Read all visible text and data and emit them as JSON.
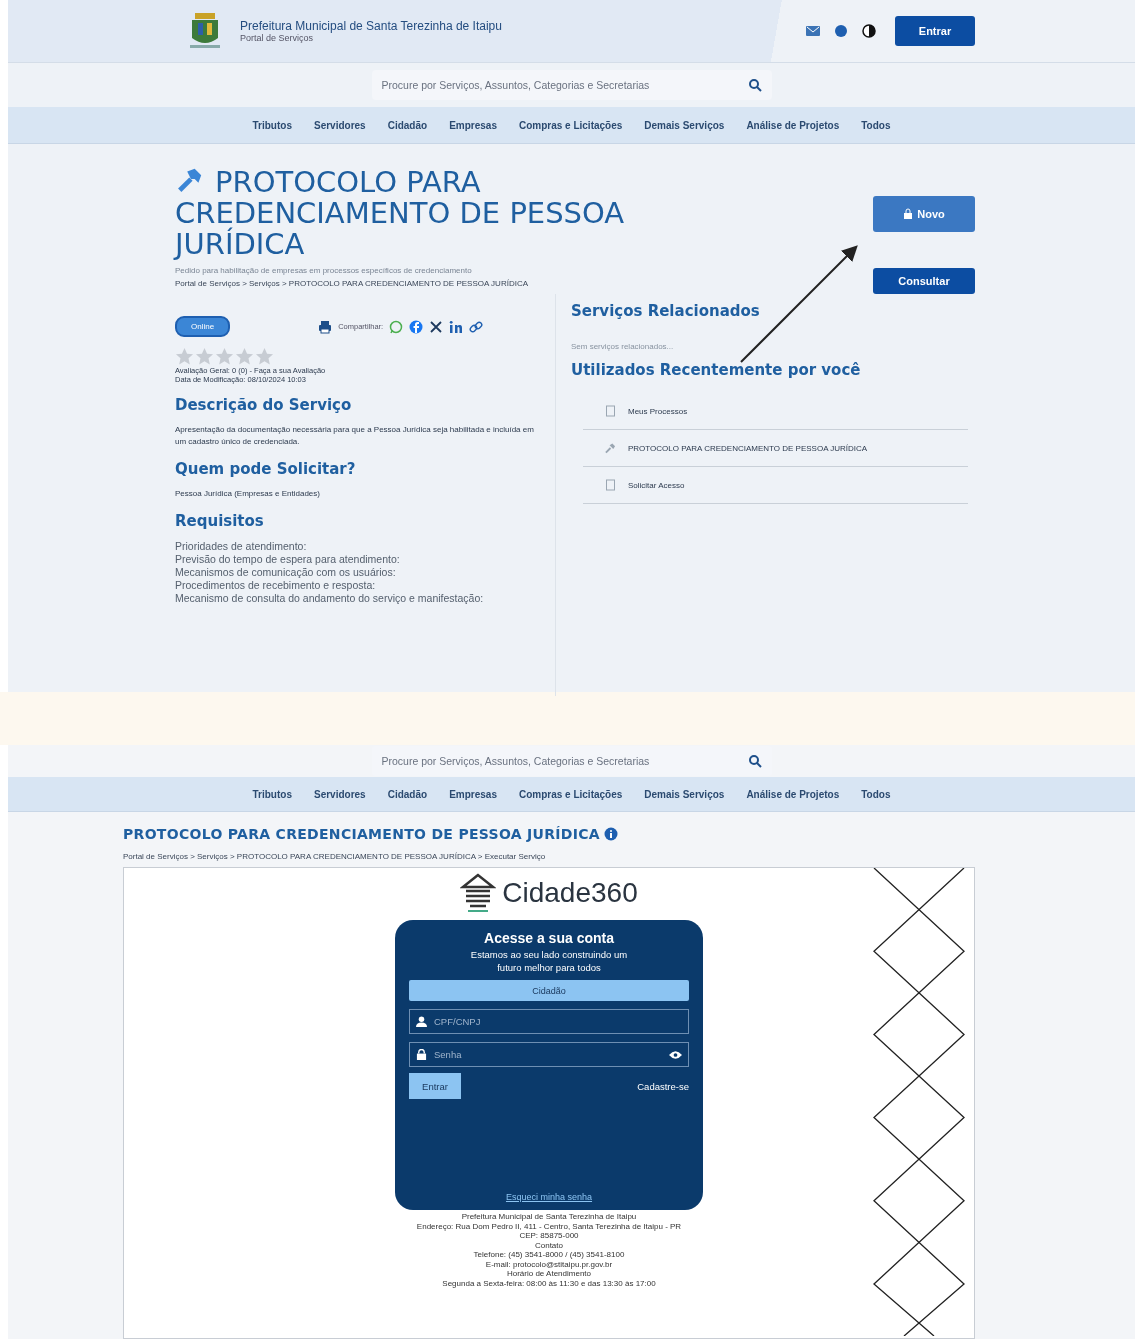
{
  "header": {
    "title": "Prefeitura Municipal de Santa Terezinha de Itaipu",
    "subtitle": "Portal de Serviços",
    "login_button": "Entrar"
  },
  "search": {
    "placeholder": "Procure por Serviços, Assuntos, Categorias e Secretarias"
  },
  "nav": [
    "Tributos",
    "Servidores",
    "Cidadão",
    "Empresas",
    "Compras e Licitações",
    "Demais Serviços",
    "Análise de Projetos",
    "Todos"
  ],
  "service": {
    "title": "PROTOCOLO PARA CREDENCIAMENTO DE PESSOA JURÍDICA",
    "summary": "Pedido para habilitação de empresas em processos específicos de credenciamento",
    "breadcrumb": "Portal de Serviços > Serviços > PROTOCOLO PARA CREDENCIAMENTO DE PESSOA JURÍDICA",
    "badge": "Online",
    "share_label": "Compartilhar:",
    "stars": 0,
    "rating": "Avaliação Geral: 0 (0) - Faça a sua Avaliação",
    "modified": "Data de Modificação: 08/10/2024 10:03",
    "sections": [
      {
        "heading": "Descrição do Serviço",
        "lines": [
          "Apresentação da documentação necessária para que a Pessoa Jurídica seja habilitada e incluída em um cadastro único de credenciada."
        ],
        "kind": "small"
      },
      {
        "heading": "Quem pode Solicitar?",
        "lines": [
          "Pessoa Jurídica (Empresas e Entidades)"
        ],
        "kind": "small"
      },
      {
        "heading": "Requisitos",
        "lines": [
          "Prioridades de atendimento:",
          "Previsão do tempo de espera para atendimento:",
          "Mecanismos de comunicação com os usuários:",
          "Procedimentos de recebimento e resposta:",
          "Mecanismo de consulta do andamento do serviço e manifestação:"
        ],
        "kind": "large"
      }
    ],
    "buttons": [
      "Novo",
      "Consultar"
    ],
    "related": {
      "heading": "Serviços Relacionados",
      "empty": "Sem serviços relacionados..."
    },
    "recent": {
      "heading": "Utilizados Recentemente por você",
      "items": [
        {
          "label": "Meus Processos",
          "kind": "document"
        },
        {
          "label": "PROTOCOLO PARA CREDENCIAMENTO DE PESSOA JURÍDICA",
          "kind": "hammer"
        },
        {
          "label": "Solicitar Acesso",
          "kind": "document"
        }
      ]
    }
  },
  "execute": {
    "search": {
      "placeholder": "Procure por Serviços, Assuntos, Categorias e Secretarias"
    },
    "nav": [
      "Tributos",
      "Servidores",
      "Cidadão",
      "Empresas",
      "Compras e Licitações",
      "Demais Serviços",
      "Análise de Projetos",
      "Todos"
    ],
    "title": "PROTOCOLO PARA CREDENCIAMENTO DE PESSOA JURÍDICA",
    "breadcrumb": "Portal de Serviços > Serviços > PROTOCOLO PARA CREDENCIAMENTO DE PESSOA JURÍDICA > Executar Serviço",
    "login": {
      "brand": "Cidade",
      "brand_number": "360",
      "title": "Acesse a sua conta",
      "subtitle": "Estamos ao seu lado construindo um futuro melhor para todos",
      "tabs": [
        {
          "label": "Cidadão",
          "selected": true
        }
      ],
      "user_placeholder": "CPF/CNPJ",
      "password_placeholder": "Senha",
      "submit": "Entrar",
      "register": "Cadastre-se",
      "forgot": "Esqueci minha senha"
    },
    "footer": [
      "Prefeitura Municipal de Santa Terezinha de Itaipu",
      "Endereço: Rua Dom Pedro II, 411 - Centro, Santa Terezinha de Itaipu - PR",
      "CEP: 85875-000",
      "Contato",
      "Telefone: (45) 3541-8000 / (45) 3541-8100",
      "E-mail: protocolo@stitaipu.pr.gov.br",
      "Horário de Atendimento",
      "Segunda a Sexta-feira: 08:00 às 11:30 e das 13:30 às 17:00"
    ]
  }
}
